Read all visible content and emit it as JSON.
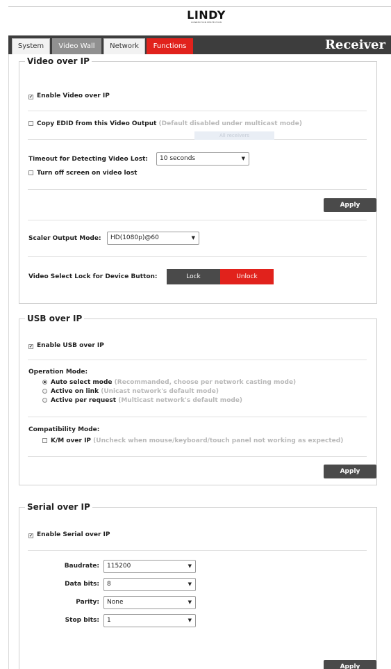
{
  "logo": {
    "text_main": "LINDY",
    "text_sub": "CONNECTION PERFECTION"
  },
  "tabs": [
    {
      "label": "System"
    },
    {
      "label": "Video Wall"
    },
    {
      "label": "Network"
    },
    {
      "label": "Functions"
    }
  ],
  "device_role": "Receiver",
  "video": {
    "legend": "Video over IP",
    "enable_label": "Enable Video over IP",
    "enable_checked": true,
    "copy_edid_label": "Copy EDID from this Video Output",
    "copy_edid_note": "(Default disabled under multicast mode)",
    "copy_edid_checked": false,
    "ghost_text": "All receivers",
    "timeout_label": "Timeout for Detecting Video Lost:",
    "timeout_value": "10 seconds",
    "turn_off_label": "Turn off screen on video lost",
    "turn_off_checked": false,
    "apply_label": "Apply",
    "scaler_label": "Scaler Output Mode:",
    "scaler_value": "HD(1080p)@60",
    "lock_row_label": "Video Select Lock for Device Button:",
    "lock_label": "Lock",
    "unlock_label": "Unlock"
  },
  "usb": {
    "legend": "USB over IP",
    "enable_label": "Enable USB over IP",
    "enable_checked": true,
    "operation_title": "Operation Mode:",
    "modes": [
      {
        "label": "Auto select mode",
        "note": "(Recommanded, choose per network casting mode)",
        "selected": true
      },
      {
        "label": "Active on link",
        "note": "(Unicast network's default mode)",
        "selected": false
      },
      {
        "label": "Active per request",
        "note": "(Multicast network's default mode)",
        "selected": false
      }
    ],
    "compat_title": "Compatibility Mode:",
    "km_label": "K/M over IP",
    "km_note": "(Uncheck when mouse/keyboard/touch panel not working as expected)",
    "km_checked": false,
    "apply_label": "Apply"
  },
  "serial": {
    "legend": "Serial over IP",
    "enable_label": "Enable Serial over IP",
    "enable_checked": true,
    "baudrate_label": "Baudrate:",
    "baudrate_value": "115200",
    "databits_label": "Data bits:",
    "databits_value": "8",
    "parity_label": "Parity:",
    "parity_value": "None",
    "stopbits_label": "Stop bits:",
    "stopbits_value": "1",
    "apply_label": "Apply"
  },
  "colors": {
    "brand_red": "#e1221c",
    "topbar": "#3d3d3d",
    "apply_button": "#4a4a4a"
  }
}
